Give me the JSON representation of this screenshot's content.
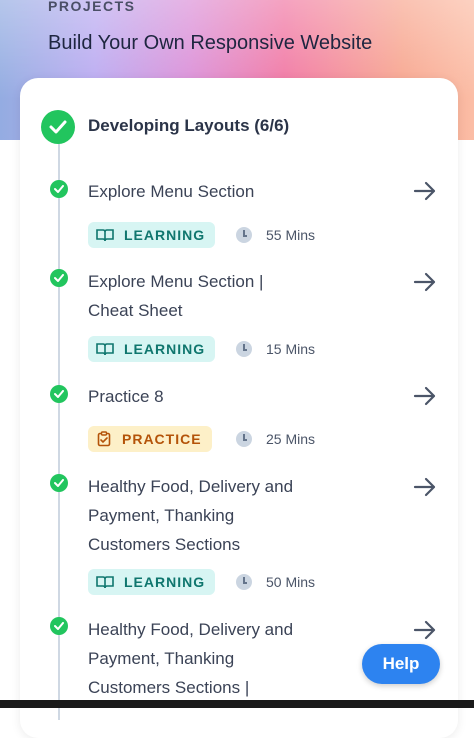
{
  "header": {
    "section_label": "PROJECTS",
    "title": "Build Your Own Responsive Website"
  },
  "section": {
    "title": "Developing Layouts (6/6)",
    "status": "completed"
  },
  "items": [
    {
      "title": "Explore Menu Section",
      "badge": "LEARNING",
      "badge_type": "learning",
      "duration": "55 Mins",
      "status": "completed"
    },
    {
      "title": "Explore Menu Section | Cheat Sheet",
      "badge": "LEARNING",
      "badge_type": "learning",
      "duration": "15 Mins",
      "status": "completed"
    },
    {
      "title": "Practice 8",
      "badge": "PRACTICE",
      "badge_type": "practice",
      "duration": "25 Mins",
      "status": "completed"
    },
    {
      "title": "Healthy Food, Delivery and Payment, Thanking Customers Sections",
      "badge": "LEARNING",
      "badge_type": "learning",
      "duration": "50 Mins",
      "status": "completed"
    },
    {
      "title": "Healthy Food, Delivery and Payment, Thanking Customers Sections |",
      "status": "completed"
    }
  ],
  "help_button": {
    "label": "Help"
  },
  "colors": {
    "success": "#22c55e",
    "learning_bg": "#d7f5f3",
    "learning_text": "#0f766e",
    "practice_bg": "#fdf0c8",
    "practice_text": "#b45309",
    "help_button": "#2d83f0"
  }
}
